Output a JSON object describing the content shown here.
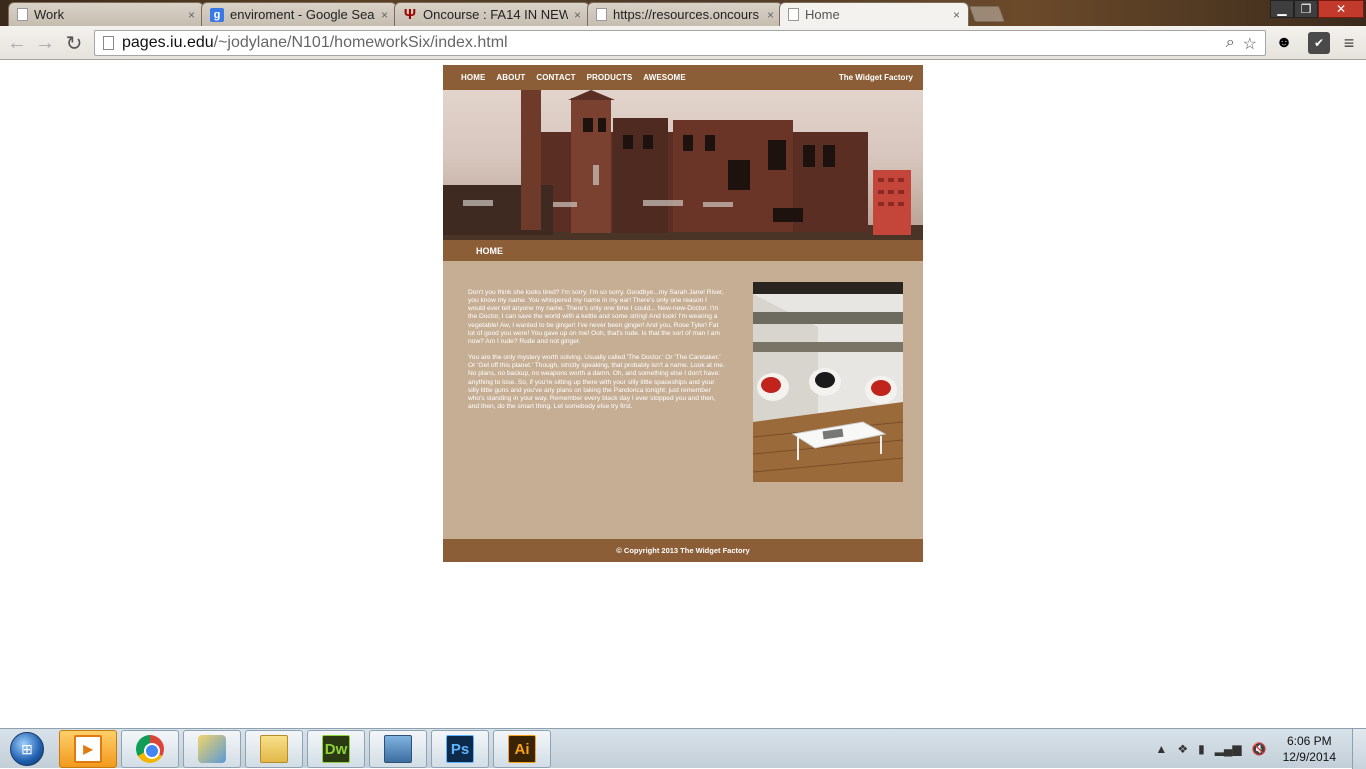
{
  "browser": {
    "tabs": [
      {
        "title": "Work",
        "icon": "page-icon"
      },
      {
        "title": "enviroment - Google Sear",
        "icon": "google-icon"
      },
      {
        "title": "Oncourse : FA14 IN NEWN",
        "icon": "iu-icon"
      },
      {
        "title": "https://resources.oncours",
        "icon": "page-icon"
      },
      {
        "title": "Home",
        "icon": "page-icon"
      }
    ],
    "tab_close": "×",
    "url_host": "pages.iu.edu",
    "url_path": "/~jodylane/N101/homeworkSix/index.html"
  },
  "site": {
    "nav": [
      "HOME",
      "ABOUT",
      "CONTACT",
      "PRODUCTS",
      "AWESOME"
    ],
    "brand": "The Widget Factory",
    "section_title": "HOME",
    "paragraphs": [
      "Don't you think she looks tired? I'm sorry. I'm so sorry. Goodbye...my Sarah Jane! River, you know my name. You whispered my name in my ear! There's only one reason I would ever tell anyone my name. There's only one time I could... New-new-Doctor. I'm the Doctor, I can save the world with a kettle and some string! And look! I'm wearing a vegetable! Aw, I wanted to be ginger! I've never been ginger! And you, Rose Tyler! Fat lot of good you were! You gave up on me! Ooh, that's rude. Is that the sort of man I am now? Am I rude? Rude and not ginger.",
      "You are the only mystery worth solving. Usually called 'The Doctor.' Or 'The Caretaker.' Or 'Get off this planet.' Though, strictly speaking, that probably isn't a name. Look at me. No plans, no backup, no weapons worth a damn. Oh, and something else I don't have: anything to lose. So, if you're sitting up there with your silly little spaceships and your silly little guns and you've any plans on taking the Pandorica tonight; just remember who's standing in your way. Remember every black day I ever stopped you and then, and then, do the smart thing. Let somebody else try first."
    ],
    "footer": "© Copyright 2013 The Widget Factory",
    "colors": {
      "brown": "#8b5e37",
      "tan": "#c6ae94"
    }
  },
  "taskbar": {
    "apps": [
      "windows-media-player",
      "chrome",
      "paint",
      "windows-explorer",
      "dreamweaver",
      "photo-viewer",
      "photoshop",
      "illustrator"
    ],
    "dw_label": "Dw",
    "ps_label": "Ps",
    "ai_label": "Ai",
    "time": "6:06 PM",
    "date": "12/9/2014"
  }
}
